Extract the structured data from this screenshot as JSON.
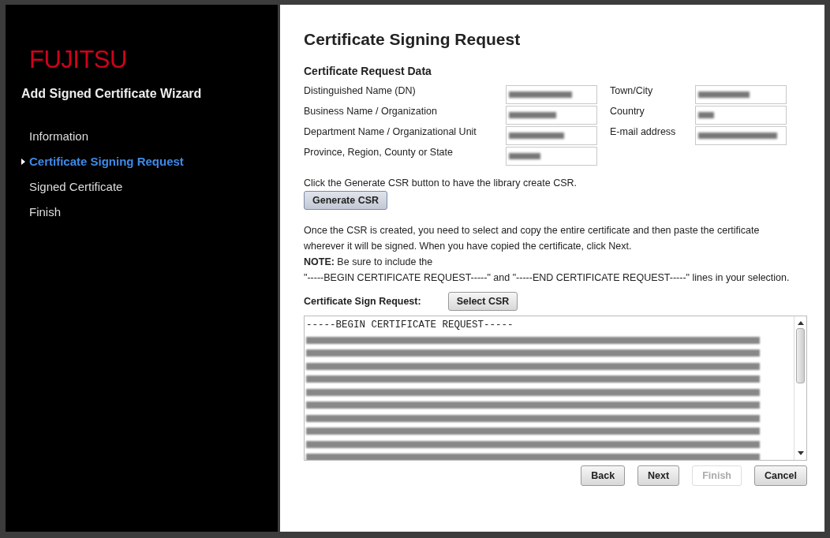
{
  "sidebar": {
    "logo": "FUJITSU",
    "title": "Add Signed Certificate Wizard",
    "steps": [
      {
        "label": "Information",
        "selected": false
      },
      {
        "label": "Certificate Signing Request",
        "selected": true
      },
      {
        "label": "Signed Certificate",
        "selected": false
      },
      {
        "label": "Finish",
        "selected": false
      }
    ]
  },
  "page_title": "Certificate Signing Request",
  "section_title": "Certificate Request Data",
  "fields_left": [
    {
      "label": "Distinguished Name (DN)"
    },
    {
      "label": "Business Name / Organization"
    },
    {
      "label": "Department Name / Organizational Unit"
    },
    {
      "label": "Province, Region, County or State"
    }
  ],
  "fields_right": [
    {
      "label": "Town/City"
    },
    {
      "label": "Country"
    },
    {
      "label": "E-mail address"
    }
  ],
  "generate_hint": "Click the Generate CSR button to have the library create CSR.",
  "generate_button": "Generate CSR",
  "instructions": "Once the CSR is created, you need to select and copy the entire certificate and then paste the certificate wherever it will be signed. When you have copied the certificate, click Next.",
  "note": "**NOTE:** Be sure to include the",
  "note_detail": "\"-----BEGIN CERTIFICATE REQUEST-----\" and \"-----END CERTIFICATE REQUEST-----\" lines in your selection.",
  "csr_label": "Certificate Sign Request:",
  "select_button": "Select CSR",
  "csr_first_line": "-----BEGIN CERTIFICATE REQUEST-----",
  "buttons": [
    {
      "label": "Back",
      "disabled": false
    },
    {
      "label": "Next",
      "disabled": false
    },
    {
      "label": "Finish",
      "disabled": true
    },
    {
      "label": "Cancel",
      "disabled": false
    }
  ]
}
